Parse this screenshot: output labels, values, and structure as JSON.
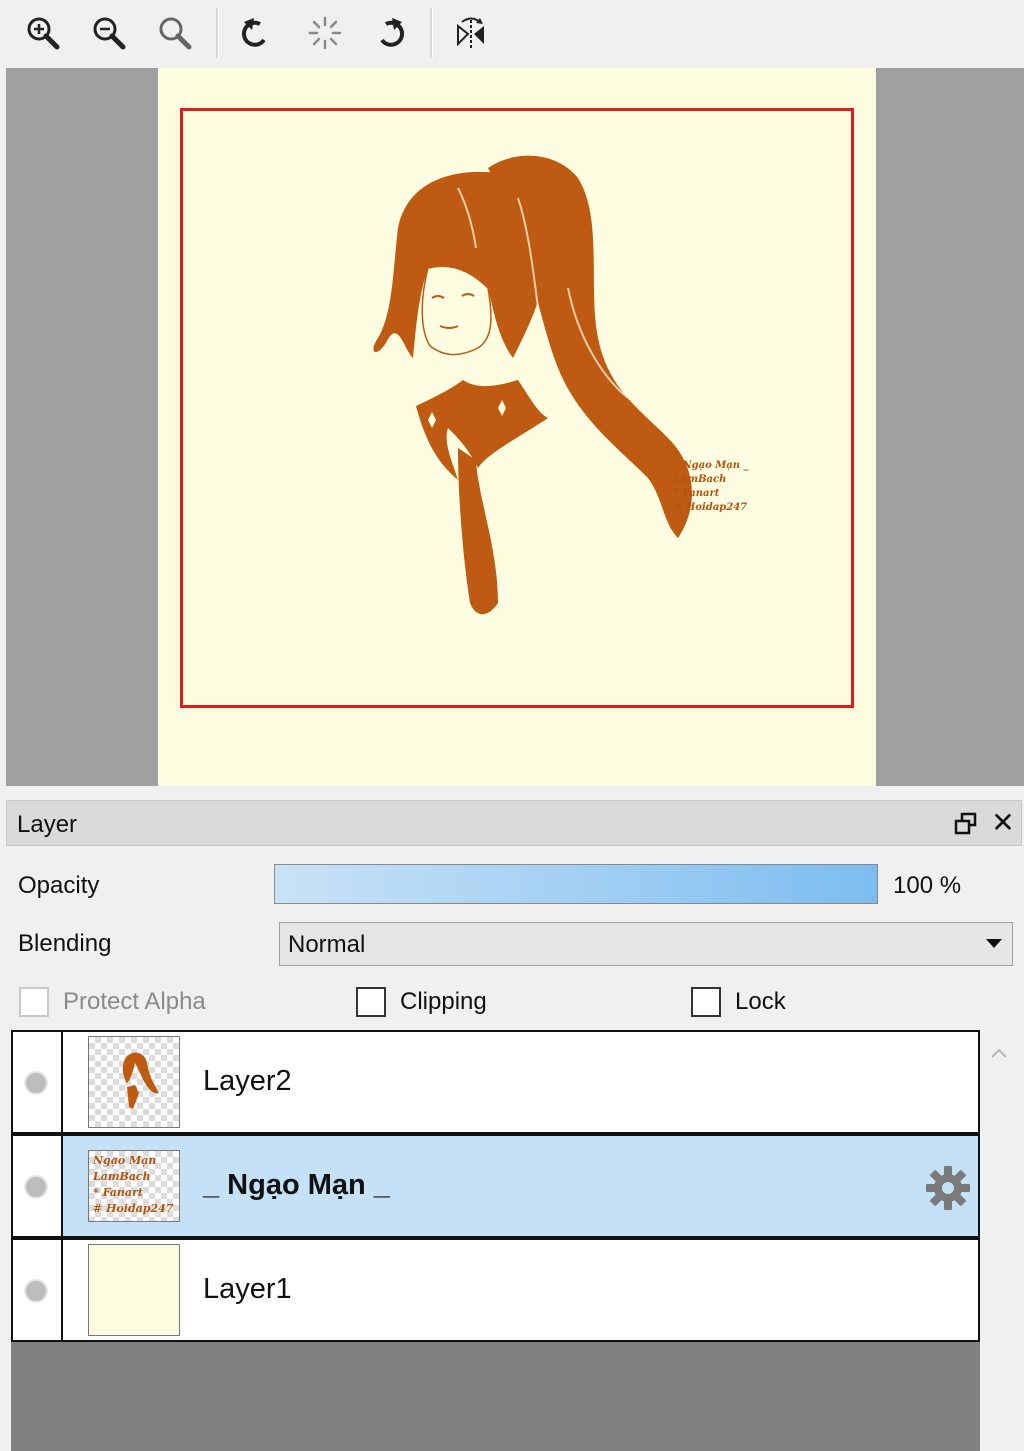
{
  "toolbar": {
    "tools": [
      {
        "name": "zoom-in-icon"
      },
      {
        "name": "zoom-out-icon"
      },
      {
        "name": "zoom-reset-icon"
      },
      {
        "name": "rotate-left-icon"
      },
      {
        "name": "rotate-reset-icon"
      },
      {
        "name": "rotate-right-icon"
      },
      {
        "name": "flip-horizontal-icon"
      }
    ]
  },
  "canvas": {
    "signature": [
      "_ Ngạo Mạn _",
      "LamBach",
      "* Fanart",
      "# Hoidap247"
    ],
    "colors": {
      "paper": "#fcfde1",
      "ink": "#b5520f",
      "selection": "#e21b1b"
    }
  },
  "layer_panel": {
    "title": "Layer",
    "opacity_label": "Opacity",
    "opacity_value": "100 %",
    "opacity_fraction": 1.0,
    "blending_label": "Blending",
    "blending_value": "Normal",
    "protect_alpha_label": "Protect Alpha",
    "clipping_label": "Clipping",
    "lock_label": "Lock",
    "layers": [
      {
        "name": "Layer2",
        "selected": false
      },
      {
        "name": "_ Ngạo Mạn _",
        "selected": true
      },
      {
        "name": "Layer1",
        "selected": false
      }
    ],
    "thumb_text": [
      "Ngạo Mạn",
      "LamBach",
      "* Fanart",
      "# Hoidap247"
    ]
  }
}
